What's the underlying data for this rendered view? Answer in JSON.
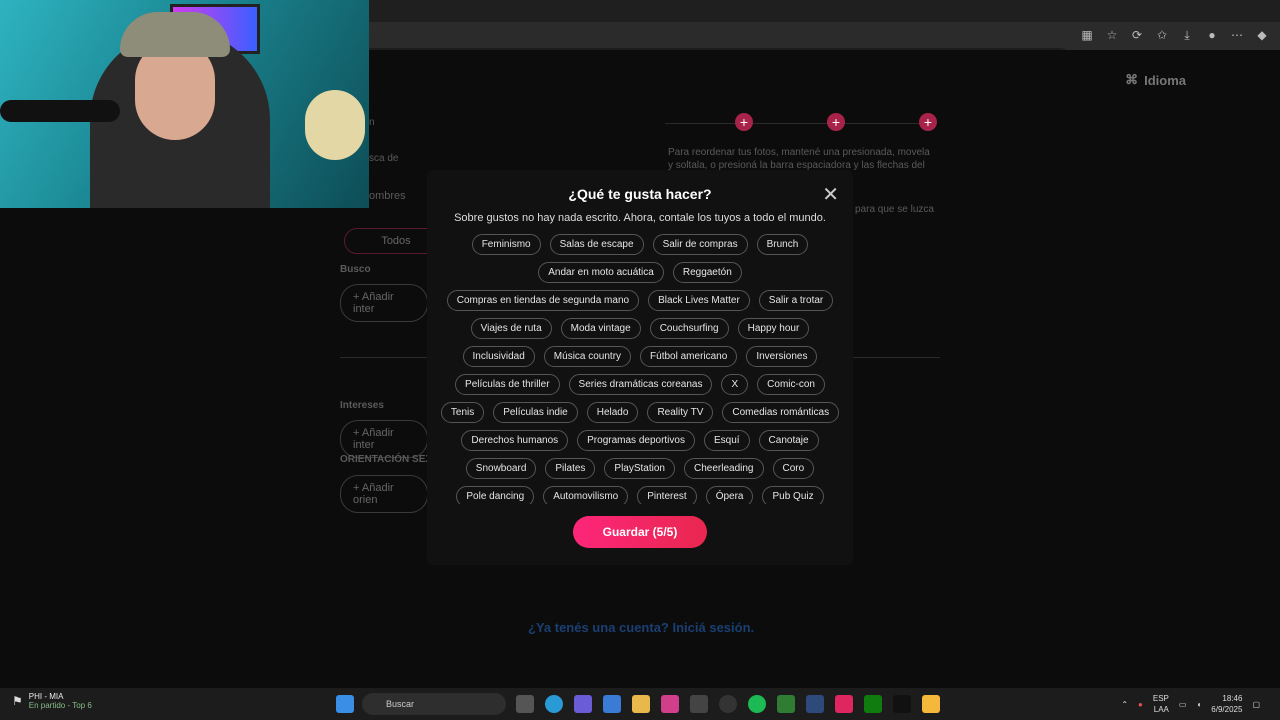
{
  "page": {
    "idioma": "Idioma",
    "reorder_hint": "Para reordenar tus fotos, mantené una presionada, movela y soltala, o presioná la barra espaciadora y las flechas del",
    "lucir_hint": "para que se luzca",
    "n_text": "n",
    "busca_de": "sca de",
    "hombres": "ombres",
    "todos": "Todos",
    "busco": "Busco",
    "anadir_1": "Añadir inter",
    "intereses": "Intereses",
    "anadir_2": "Añadir inter",
    "orientacion": "ORIENTACIÓN SEX",
    "anadir_3": "Añadir orien",
    "login_link": "¿Ya tenés una cuenta? Iniciá sesión."
  },
  "modal": {
    "title": "¿Qué te gusta hacer?",
    "subtitle": "Sobre gustos no hay nada escrito. Ahora, contale los tuyos a todo el mundo.",
    "close": "✕",
    "save_label": "Guardar (5/5)",
    "tag_rows": [
      [
        "Feminismo",
        "Salas de escape",
        "Salir de compras",
        "Brunch"
      ],
      [
        "Andar en moto acuática",
        "Reggaetón"
      ],
      [
        "Compras en tiendas de segunda mano",
        "Black Lives Matter",
        "Salir a trotar"
      ],
      [
        "Viajes de ruta",
        "Moda vintage",
        "Couchsurfing",
        "Happy hour"
      ],
      [
        "Inclusividad",
        "Música country",
        "Fútbol americano",
        "Inversiones"
      ],
      [
        "Películas de thriller",
        "Series dramáticas coreanas",
        "X",
        "Comic-con"
      ],
      [
        "Tenis",
        "Películas indie",
        "Helado",
        "Reality TV",
        "Comedias románticas"
      ],
      [
        "Derechos humanos",
        "Programas deportivos",
        "Esquí",
        "Canotaje"
      ],
      [
        "Snowboard",
        "Pilates",
        "PlayStation",
        "Cheerleading",
        "Coro"
      ],
      [
        "Pole dancing",
        "Automovilismo",
        "Pinterest",
        "Ópera",
        "Pub Quiz"
      ]
    ]
  },
  "taskbar": {
    "stock_name": "PHI - MIA",
    "stock_status": "En partido - Top 6",
    "search_label": "Buscar",
    "lang_1": "ESP",
    "lang_2": "LAA",
    "time": "18:46",
    "date": "6/9/2025"
  },
  "colors": {
    "accent": "#fd267a",
    "modal_bg": "#111111"
  }
}
